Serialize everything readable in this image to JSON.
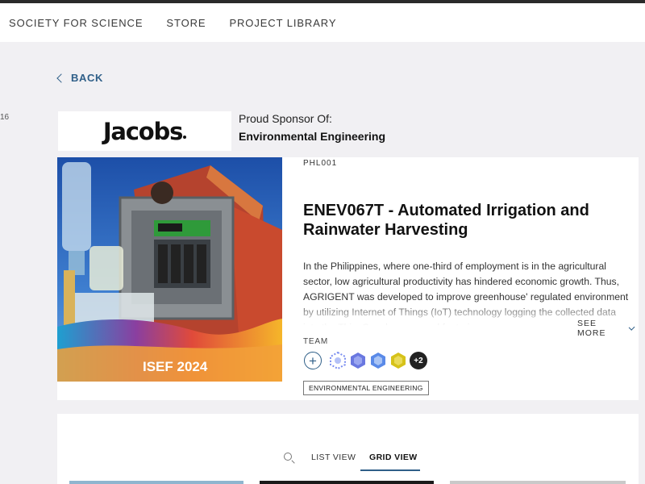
{
  "nav": {
    "items": [
      "SOCIETY FOR SCIENCE",
      "STORE",
      "PROJECT LIBRARY"
    ]
  },
  "edge_number": "16",
  "back_label": "BACK",
  "sponsor": {
    "logo_text": "Jacobs",
    "label": "Proud Sponsor Of:",
    "category": "Environmental Engineering"
  },
  "project": {
    "image_text": "ISEF 2024",
    "code": "PHL001",
    "title": "ENEV067T - Automated Irrigation and Rainwater Harvesting",
    "abstract": "In the Philippines, where one-third of employment is in the agricultural sector, low agricultural productivity has hindered economic growth. Thus, AGRIGENT was developed to improve greenhouse' regulated environment by utilizing Internet of Things (IoT) technology logging the collected data into the ThingSpeak server and featuring",
    "see_more": "SEE MORE",
    "team_label": "TEAM",
    "team_extra": "+2",
    "tag": "ENVIRONMENTAL ENGINEERING"
  },
  "views": {
    "list": "LIST VIEW",
    "grid": "GRID VIEW"
  },
  "colors": {
    "accent": "#2f5f88",
    "background": "#f1f0f3"
  }
}
